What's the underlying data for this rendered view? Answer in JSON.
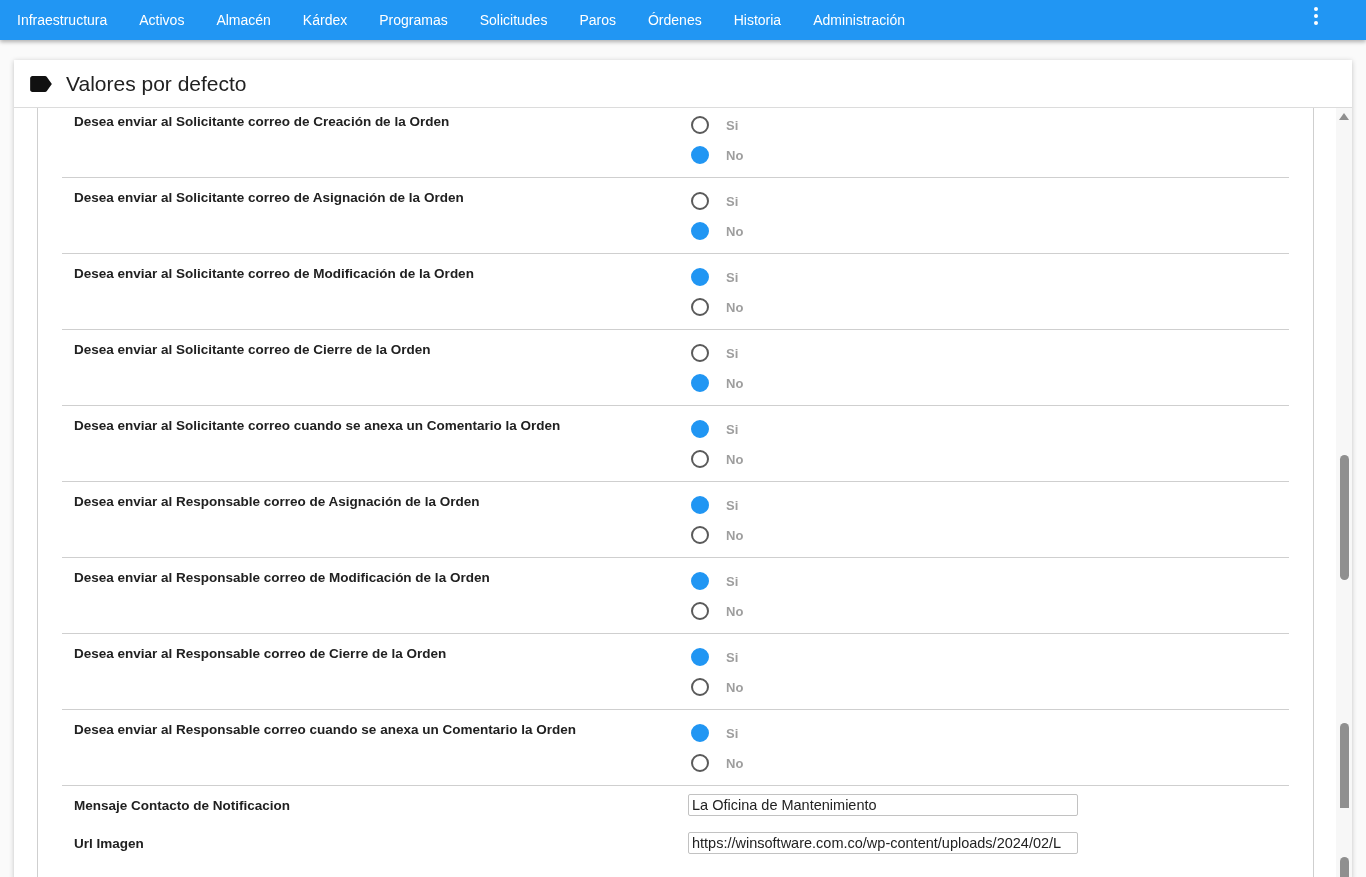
{
  "nav": {
    "items": [
      "Infraestructura",
      "Activos",
      "Almacén",
      "Kárdex",
      "Programas",
      "Solicitudes",
      "Paros",
      "Órdenes",
      "Historia",
      "Administración"
    ]
  },
  "card": {
    "title": "Valores por defecto",
    "options": [
      {
        "label": "Desea enviar al Solicitante correo de Creación de la Orden",
        "choices": [
          {
            "label": "Si",
            "selected": false
          },
          {
            "label": "No",
            "selected": true
          }
        ]
      },
      {
        "label": "Desea enviar al Solicitante correo de Asignación de la Orden",
        "choices": [
          {
            "label": "Si",
            "selected": false
          },
          {
            "label": "No",
            "selected": true
          }
        ]
      },
      {
        "label": "Desea enviar al Solicitante correo de Modificación de la Orden",
        "choices": [
          {
            "label": "Si",
            "selected": true
          },
          {
            "label": "No",
            "selected": false
          }
        ]
      },
      {
        "label": "Desea enviar al Solicitante correo de Cierre de la Orden",
        "choices": [
          {
            "label": "Si",
            "selected": false
          },
          {
            "label": "No",
            "selected": true
          }
        ]
      },
      {
        "label": "Desea enviar al Solicitante correo cuando se anexa un Comentario la Orden",
        "choices": [
          {
            "label": "Si",
            "selected": true
          },
          {
            "label": "No",
            "selected": false
          }
        ]
      },
      {
        "label": "Desea enviar al Responsable correo de Asignación de la Orden",
        "choices": [
          {
            "label": "Si",
            "selected": true
          },
          {
            "label": "No",
            "selected": false
          }
        ]
      },
      {
        "label": "Desea enviar al Responsable correo de Modificación de la Orden",
        "choices": [
          {
            "label": "Si",
            "selected": true
          },
          {
            "label": "No",
            "selected": false
          }
        ]
      },
      {
        "label": "Desea enviar al Responsable correo de Cierre de la Orden",
        "choices": [
          {
            "label": "Si",
            "selected": true
          },
          {
            "label": "No",
            "selected": false
          }
        ]
      },
      {
        "label": "Desea enviar al Responsable correo cuando se anexa un Comentario la Orden",
        "choices": [
          {
            "label": "Si",
            "selected": true
          },
          {
            "label": "No",
            "selected": false
          }
        ]
      }
    ],
    "fields": [
      {
        "label": "Mensaje Contacto de Notificacion",
        "value": "La Oficina de Mantenimiento"
      },
      {
        "label": "Url Imagen",
        "value": "https://winsoftware.com.co/wp-content/uploads/2024/02/L"
      }
    ]
  }
}
